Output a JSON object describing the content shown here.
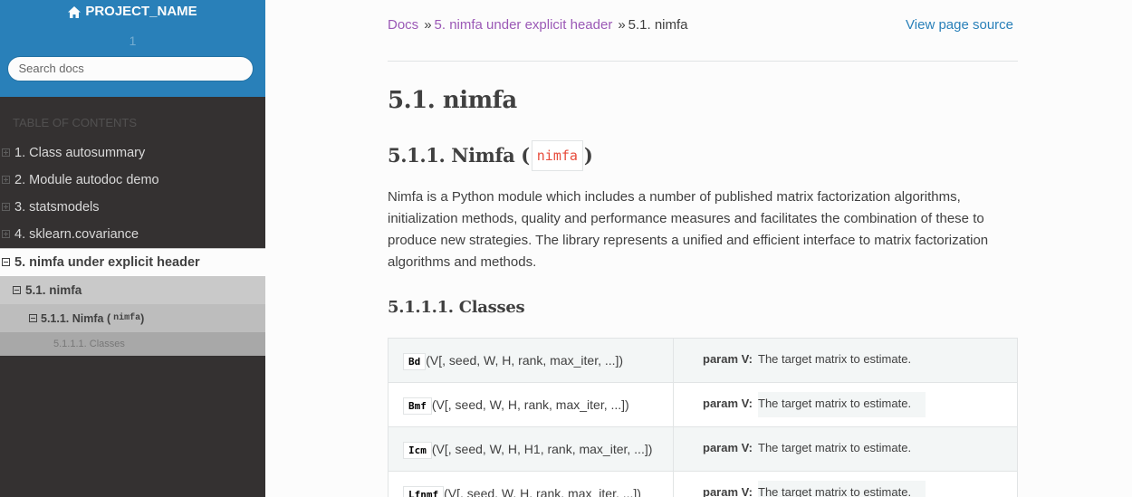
{
  "sidebar": {
    "project_name": "PROJECT_NAME",
    "version": "1",
    "search_placeholder": "Search docs",
    "caption": "TABLE OF CONTENTS",
    "items": [
      {
        "label": "1. Class autosummary"
      },
      {
        "label": "2. Module autodoc demo"
      },
      {
        "label": "3. statsmodels"
      },
      {
        "label": "4. sklearn.covariance"
      }
    ],
    "current": {
      "label": "5. nimfa under explicit header"
    },
    "sub": {
      "label": "5.1. nimfa"
    },
    "subsub": {
      "label": "5.1.1. Nimfa (",
      "code": "nimfa",
      "after": ")"
    },
    "subsubsub": {
      "label": "5.1.1.1. Classes"
    }
  },
  "breadcrumbs": {
    "docs": "Docs",
    "sep": "»",
    "parent": "5. nimfa under explicit header",
    "current": "5.1. nimfa",
    "view_source": "View page source"
  },
  "content": {
    "h1": "5.1. nimfa",
    "h2_pre": "5.1.1. Nimfa (",
    "h2_code": "nimfa",
    "h2_post": ")",
    "paragraph": "Nimfa is a Python module which includes a number of published matrix factorization algorithms, initialization methods, quality and performance measures and facilitates the combination of these to produce new strategies. The library represents a unified and efficient interface to matrix factorization algorithms and methods.",
    "h3": "5.1.1.1. Classes",
    "table": [
      {
        "name": "Bd",
        "sig": "(V[, seed, W, H, rank, max_iter, ...])",
        "param_label": "param V:",
        "param_desc": "The target matrix to estimate."
      },
      {
        "name": "Bmf",
        "sig": "(V[, seed, W, H, rank, max_iter, ...])",
        "param_label": "param V:",
        "param_desc": "The target matrix to estimate."
      },
      {
        "name": "Icm",
        "sig": "(V[, seed, W, H, H1, rank, max_iter, ...])",
        "param_label": "param V:",
        "param_desc": "The target matrix to estimate."
      },
      {
        "name": "Lfnmf",
        "sig": "(V[, seed, W, H, rank, max_iter, ...])",
        "param_label": "param V:",
        "param_desc": "The target matrix to estimate."
      }
    ]
  },
  "colors": {
    "sidebar_bg": "#343131",
    "sidebar_top": "#2980b9",
    "link": "#2980b9",
    "visited_link": "#9b59b6",
    "code_red": "#e74c3c"
  }
}
